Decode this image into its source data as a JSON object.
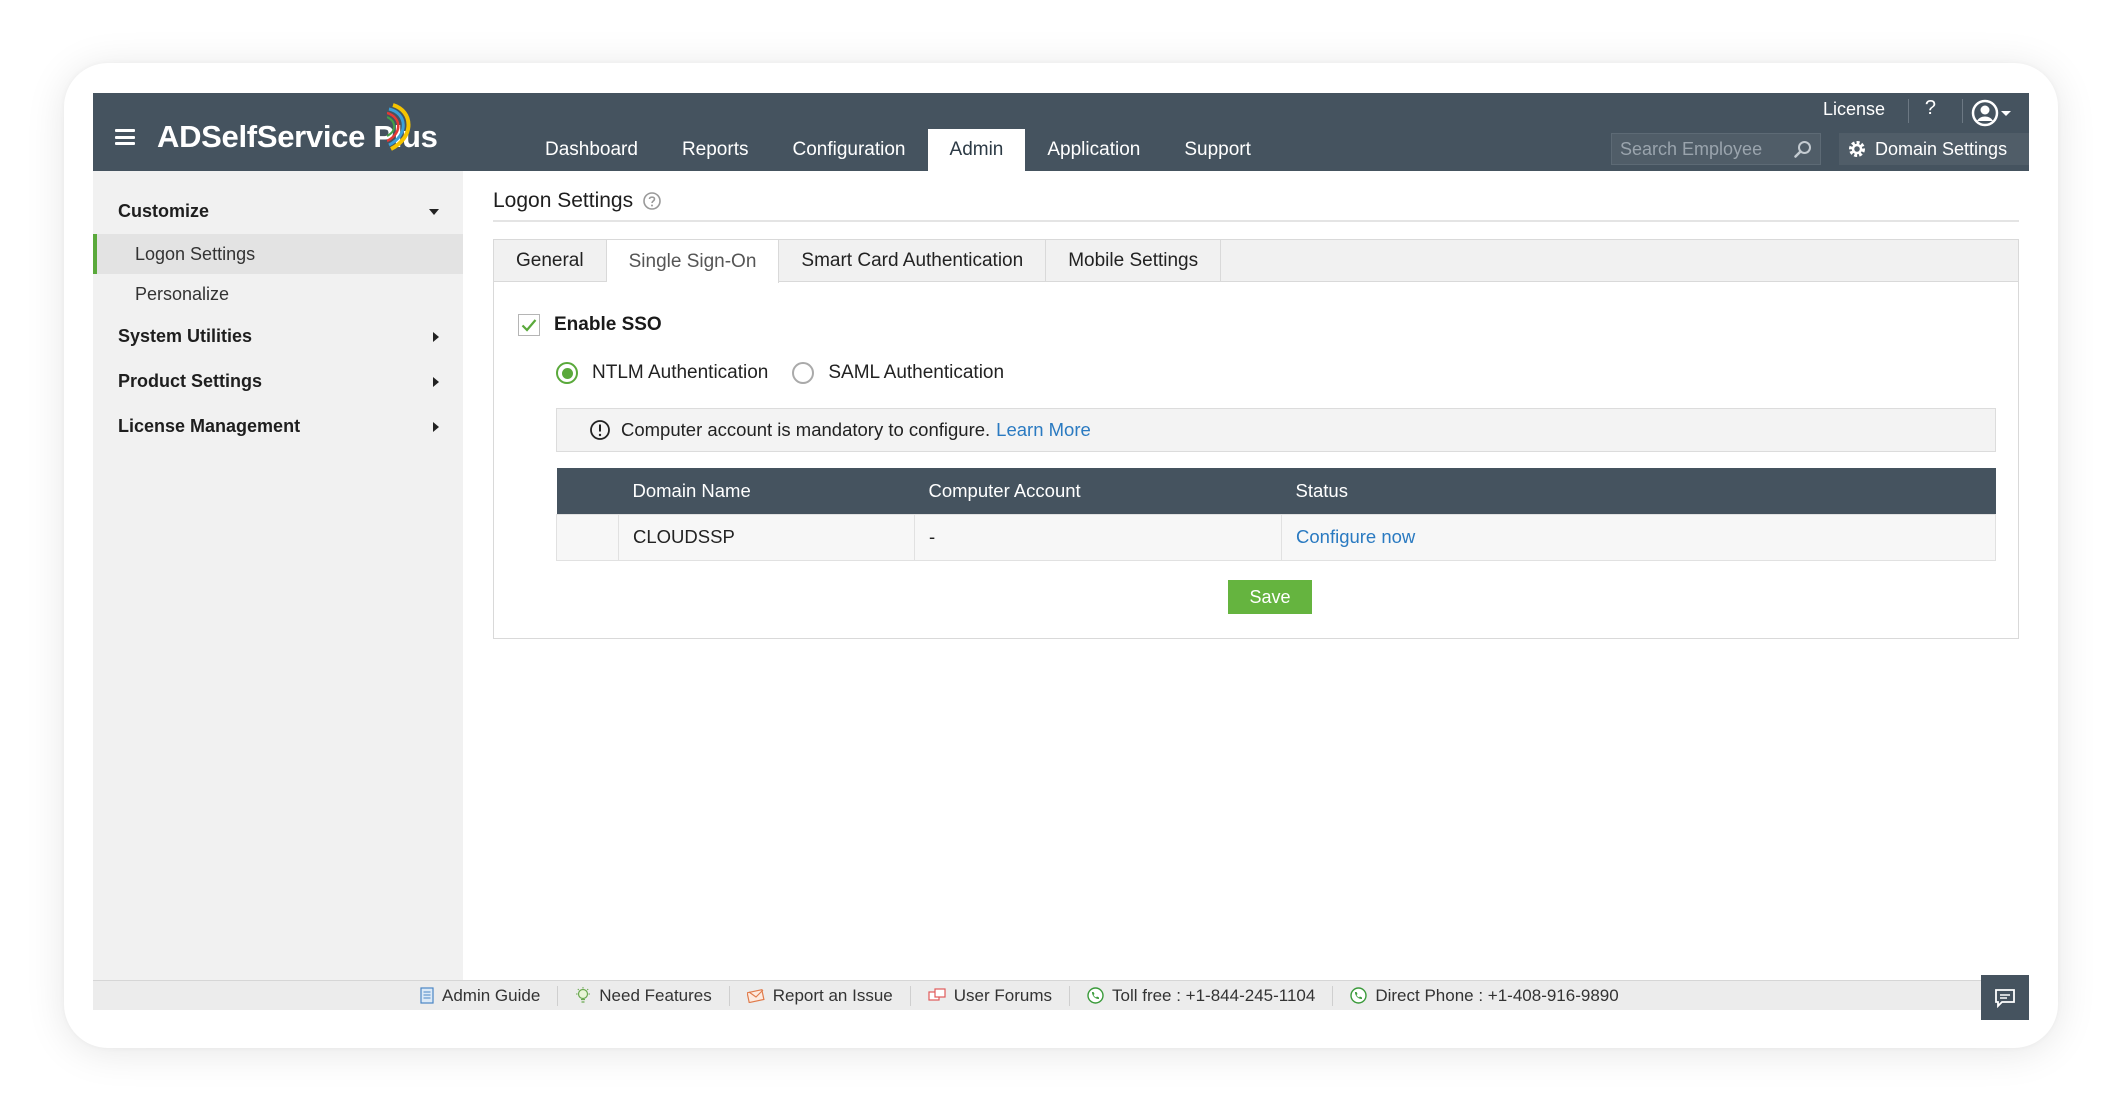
{
  "brand": {
    "name": "ADSelfService Plus"
  },
  "nav": {
    "tabs": [
      {
        "label": "Dashboard"
      },
      {
        "label": "Reports"
      },
      {
        "label": "Configuration"
      },
      {
        "label": "Admin",
        "active": true
      },
      {
        "label": "Application"
      },
      {
        "label": "Support"
      }
    ]
  },
  "header": {
    "license_label": "License",
    "help_label": "?",
    "search_placeholder": "Search Employee",
    "domain_settings_label": "Domain Settings"
  },
  "sidebar": {
    "groups": [
      {
        "label": "Customize",
        "expanded": true,
        "items": [
          {
            "label": "Logon Settings",
            "active": true
          },
          {
            "label": "Personalize"
          }
        ]
      },
      {
        "label": "System Utilities"
      },
      {
        "label": "Product Settings"
      },
      {
        "label": "License Management"
      }
    ]
  },
  "page": {
    "title": "Logon Settings"
  },
  "tabs": [
    {
      "label": "General"
    },
    {
      "label": "Single Sign-On",
      "active": true
    },
    {
      "label": "Smart Card Authentication"
    },
    {
      "label": "Mobile Settings"
    }
  ],
  "sso": {
    "enable_label": "Enable SSO",
    "enabled": true,
    "auth_options": [
      {
        "label": "NTLM Authentication",
        "selected": true
      },
      {
        "label": "SAML Authentication",
        "selected": false
      }
    ],
    "notice_text": "Computer account is mandatory to configure.",
    "notice_link": "Learn More"
  },
  "table": {
    "headers": [
      "Domain Name",
      "Computer Account",
      "Status"
    ],
    "rows": [
      {
        "domain": "CLOUDSSP",
        "account": "-",
        "status": "Configure now"
      }
    ]
  },
  "actions": {
    "save_label": "Save"
  },
  "footer": {
    "items": [
      "Admin Guide",
      "Need Features",
      "Report an Issue",
      "User Forums",
      "Toll free : +1-844-245-1104",
      "Direct Phone : +1-408-916-9890"
    ]
  },
  "colors": {
    "header": "#45535f",
    "accent_green": "#65b43f",
    "link_blue": "#2a7ac1"
  }
}
